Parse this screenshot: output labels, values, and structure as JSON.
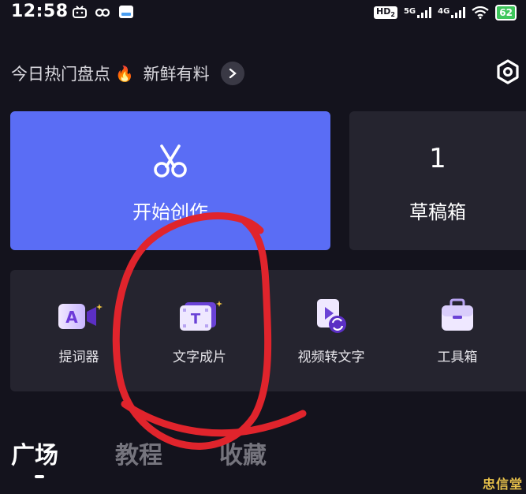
{
  "status_bar": {
    "time": "12:58",
    "hd_badge": "HD",
    "hd_sub": "2",
    "net1": "5G",
    "net2": "4G",
    "battery": "62"
  },
  "headline": {
    "text": "今日热门盘点",
    "emoji": "🔥",
    "text2": "新鲜有料"
  },
  "create_card": {
    "label": "开始创作"
  },
  "drafts_card": {
    "count": "1",
    "label": "草稿箱"
  },
  "tools": [
    {
      "label": "提词器",
      "icon": "teleprompter-icon"
    },
    {
      "label": "文字成片",
      "icon": "text-to-video-icon"
    },
    {
      "label": "视频转文字",
      "icon": "video-to-text-icon"
    },
    {
      "label": "工具箱",
      "icon": "toolbox-icon"
    }
  ],
  "tabs": [
    {
      "label": "广场",
      "active": true
    },
    {
      "label": "教程",
      "active": false
    },
    {
      "label": "收藏",
      "active": false
    }
  ],
  "watermark": {
    "corner_stamp": "忠信堂"
  },
  "colors": {
    "background": "#14131d",
    "create_card": "#5a6df5",
    "panel": "#25242f",
    "annotation": "#e0242c"
  }
}
